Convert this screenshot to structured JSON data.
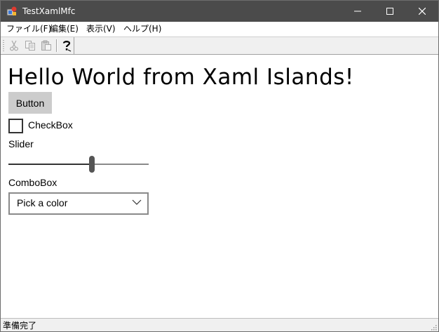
{
  "window": {
    "title": "TestXamlMfc"
  },
  "menu": {
    "items": [
      "ファイル(F)",
      "編集(E)",
      "表示(V)",
      "ヘルプ(H)"
    ]
  },
  "toolbar": {
    "buttons": [
      {
        "icon": "cut-icon",
        "enabled": false
      },
      {
        "icon": "copy-icon",
        "enabled": false
      },
      {
        "icon": "paste-icon",
        "enabled": false
      },
      {
        "icon": "help-icon",
        "enabled": true
      }
    ]
  },
  "content": {
    "heading": "Hello World from Xaml Islands!",
    "button_label": "Button",
    "checkbox_label": "CheckBox",
    "checkbox_checked": false,
    "slider_header": "Slider",
    "slider_value_fraction": 0.6,
    "combo_header": "ComboBox",
    "combo_placeholder": "Pick a color"
  },
  "status": {
    "text": "準備完了"
  },
  "colors": {
    "titlebar": "#4b4b4b",
    "button_bg": "#cccccc",
    "slider_thumb": "#555555"
  }
}
